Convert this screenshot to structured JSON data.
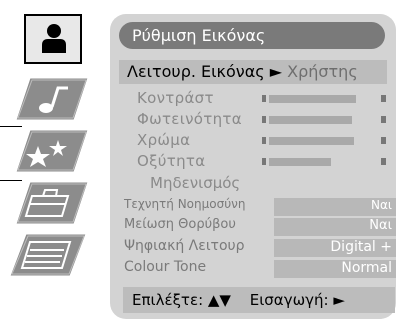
{
  "menu": {
    "title": "Ρύθμιση Εικόνας",
    "mode": {
      "label": "Λειτουρ. Εικόνας",
      "arrow": "►",
      "value": "Χρήστης"
    },
    "sliders": [
      {
        "label": "Κοντράστ",
        "level": 0.78
      },
      {
        "label": "Φωτεινότητα",
        "level": 0.74
      },
      {
        "label": "Χρώμα",
        "level": 0.76
      },
      {
        "label": "Οξύτητα",
        "level": 0.55
      }
    ],
    "reset_label": "Μηδενισμός",
    "options": [
      {
        "label": "Τεχνητή Νοημοσύνη",
        "value": "Ναι"
      },
      {
        "label": "Μείωση Θορύβου",
        "value": "Ναι"
      },
      {
        "label": "Ψηφιακή Λειτουρ",
        "value": "Digital +"
      },
      {
        "label": "Colour Tone",
        "value": "Normal"
      }
    ],
    "footer": {
      "select": "Επιλέξτε: ▲▼",
      "enter": "Εισαγωγή: ►"
    }
  },
  "icons": {
    "active": "user-icon",
    "tiles": [
      "music-note-icon",
      "stars-icon",
      "briefcase-icon",
      "document-lines-icon"
    ]
  },
  "colors": {
    "panel": "#d3d3d3",
    "title_pill": "#7a7a7a",
    "tile_fill": "#8c8c8c"
  }
}
